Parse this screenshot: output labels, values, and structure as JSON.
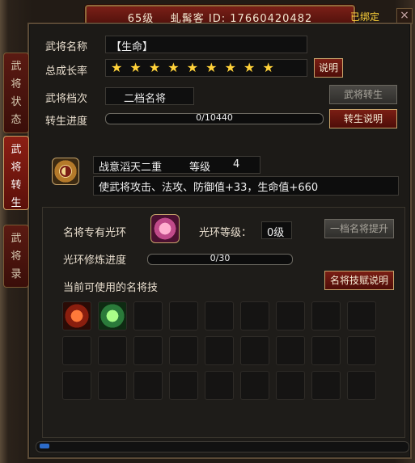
{
  "header": {
    "title": "65级    虬髯客 ID: 17660420482",
    "bound": "已绑定",
    "close": "×"
  },
  "tabs": [
    {
      "label": "武将状态"
    },
    {
      "label": "武将转生"
    },
    {
      "label": "武将录"
    }
  ],
  "general": {
    "name_label": "武将名称",
    "name_value": "【生命】",
    "growth_label": "总成长率",
    "stars": 9,
    "stars_text": "★ ★ ★ ★ ★ ★ ★ ★ ★",
    "explain_btn": "说明",
    "grade_label": "武将档次",
    "grade_value": "二档名将",
    "rebirth_btn": "武将转生",
    "progress_label": "转生进度",
    "progress_text": "0/10440",
    "progress_value": 0,
    "rebirth_explain_btn": "转生说明"
  },
  "skill": {
    "name": "战意滔天二重",
    "level_label": "等级",
    "level": "4",
    "desc": "使武将攻击、法攻、防御值+33，生命值+660"
  },
  "aura": {
    "title": "名将专有光环",
    "level_label": "光环等级：",
    "level_value": "0级",
    "upgrade_btn": "一档名将提升",
    "train_label": "光环修炼进度",
    "train_text": "0/30",
    "train_value": 0,
    "usable_label": "当前可使用的名将技",
    "talent_btn": "名将技赋说明"
  },
  "colors": {
    "accent": "#ffd23a",
    "button": "#7a1e14"
  }
}
